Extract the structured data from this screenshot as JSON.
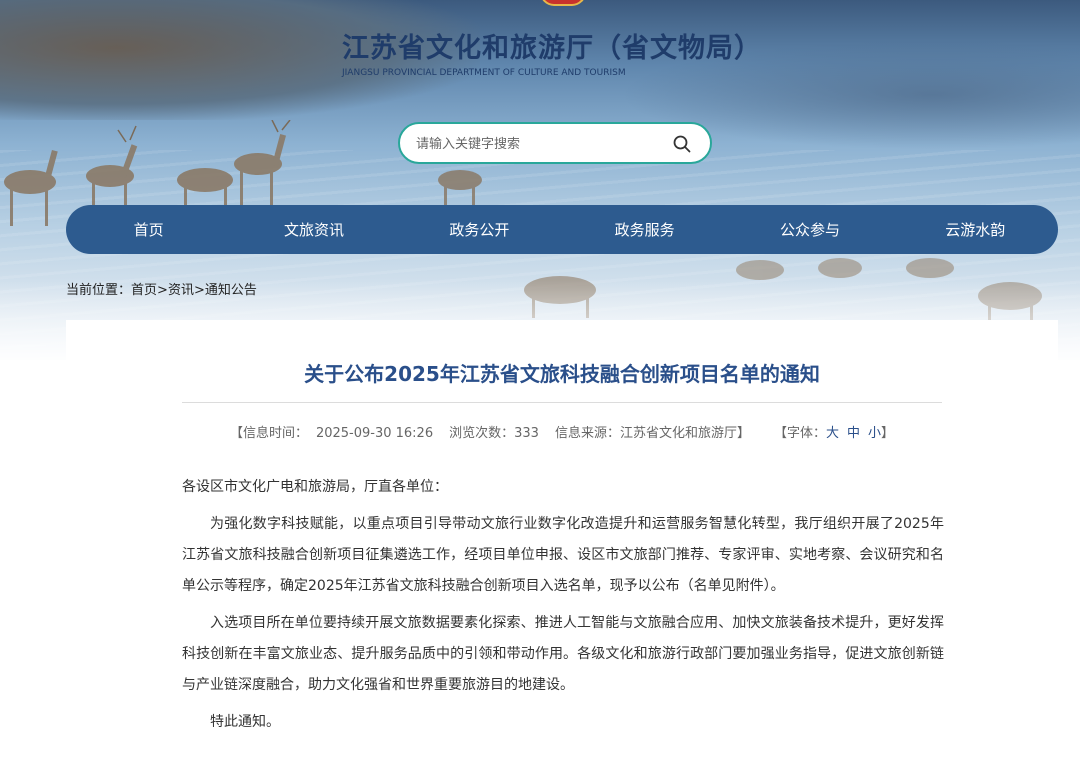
{
  "header": {
    "site_title": "江苏省文化和旅游厅（省文物局）",
    "site_subtitle": "JIANGSU PROVINCIAL DEPARTMENT OF CULTURE AND TOURISM",
    "search_placeholder": "请输入关键字搜索"
  },
  "nav": {
    "items": [
      {
        "label": "首页"
      },
      {
        "label": "文旅资讯"
      },
      {
        "label": "政务公开"
      },
      {
        "label": "政务服务"
      },
      {
        "label": "公众参与"
      },
      {
        "label": "云游水韵"
      }
    ]
  },
  "breadcrumb": {
    "prefix": "当前位置：",
    "items": [
      "首页",
      "资讯",
      "通知公告"
    ],
    "separator": ">"
  },
  "article": {
    "title": "关于公布2025年江苏省文旅科技融合创新项目名单的通知",
    "meta": {
      "time_label": "【信息时间：",
      "time": "2025-09-30 16:26",
      "views_label": "浏览次数：",
      "views": "333",
      "source_label": "信息来源：",
      "source": "江苏省文化和旅游厅】",
      "font_label": "【字体：",
      "font_large": "大",
      "font_medium": "中",
      "font_small": "小",
      "font_close": "】"
    },
    "paragraphs": [
      "各设区市文化广电和旅游局，厅直各单位：",
      "为强化数字科技赋能，以重点项目引导带动文旅行业数字化改造提升和运营服务智慧化转型，我厅组织开展了2025年江苏省文旅科技融合创新项目征集遴选工作，经项目单位申报、设区市文旅部门推荐、专家评审、实地考察、会议研究和名单公示等程序，确定2025年江苏省文旅科技融合创新项目入选名单，现予以公布（名单见附件）。",
      "入选项目所在单位要持续开展文旅数据要素化探索、推进人工智能与文旅融合应用、加快文旅装备技术提升，更好发挥科技创新在丰富文旅业态、提升服务品质中的引领和带动作用。各级文化和旅游行政部门要加强业务指导，促进文旅创新链与产业链深度融合，助力文化强省和世界重要旅游目的地建设。",
      "特此通知。"
    ]
  },
  "colors": {
    "nav_bg": "#2d5b8f",
    "title_text": "#2a4f8a",
    "search_border": "#29a79a"
  }
}
